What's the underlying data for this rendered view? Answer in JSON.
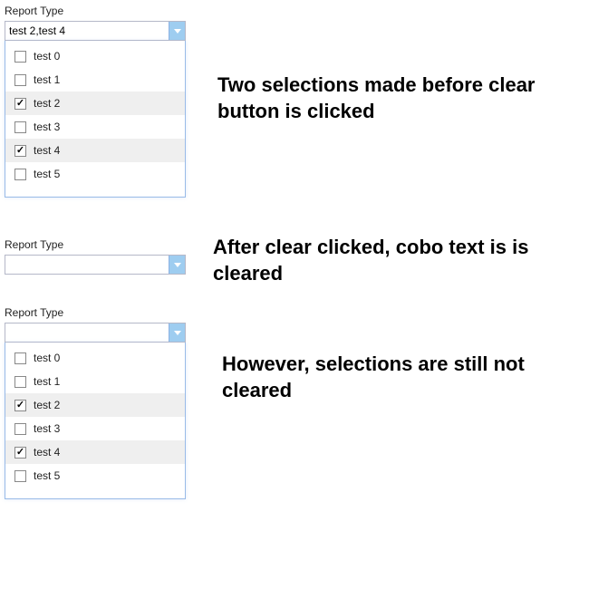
{
  "panel1": {
    "label": "Report Type",
    "value": "test 2,test 4",
    "options": [
      {
        "label": "test 0",
        "checked": false
      },
      {
        "label": "test 1",
        "checked": false
      },
      {
        "label": "test 2",
        "checked": true
      },
      {
        "label": "test 3",
        "checked": false
      },
      {
        "label": "test 4",
        "checked": true
      },
      {
        "label": "test 5",
        "checked": false
      }
    ],
    "annotation": "Two selections made before clear button is clicked"
  },
  "panel2": {
    "label": "Report Type",
    "value": "",
    "annotation": "After clear clicked, cobo text is is cleared"
  },
  "panel3": {
    "label": "Report Type",
    "value": "",
    "options": [
      {
        "label": "test 0",
        "checked": false
      },
      {
        "label": "test 1",
        "checked": false
      },
      {
        "label": "test 2",
        "checked": true
      },
      {
        "label": "test 3",
        "checked": false
      },
      {
        "label": "test 4",
        "checked": true
      },
      {
        "label": "test 5",
        "checked": false
      }
    ],
    "annotation": "However, selections are still not cleared"
  }
}
